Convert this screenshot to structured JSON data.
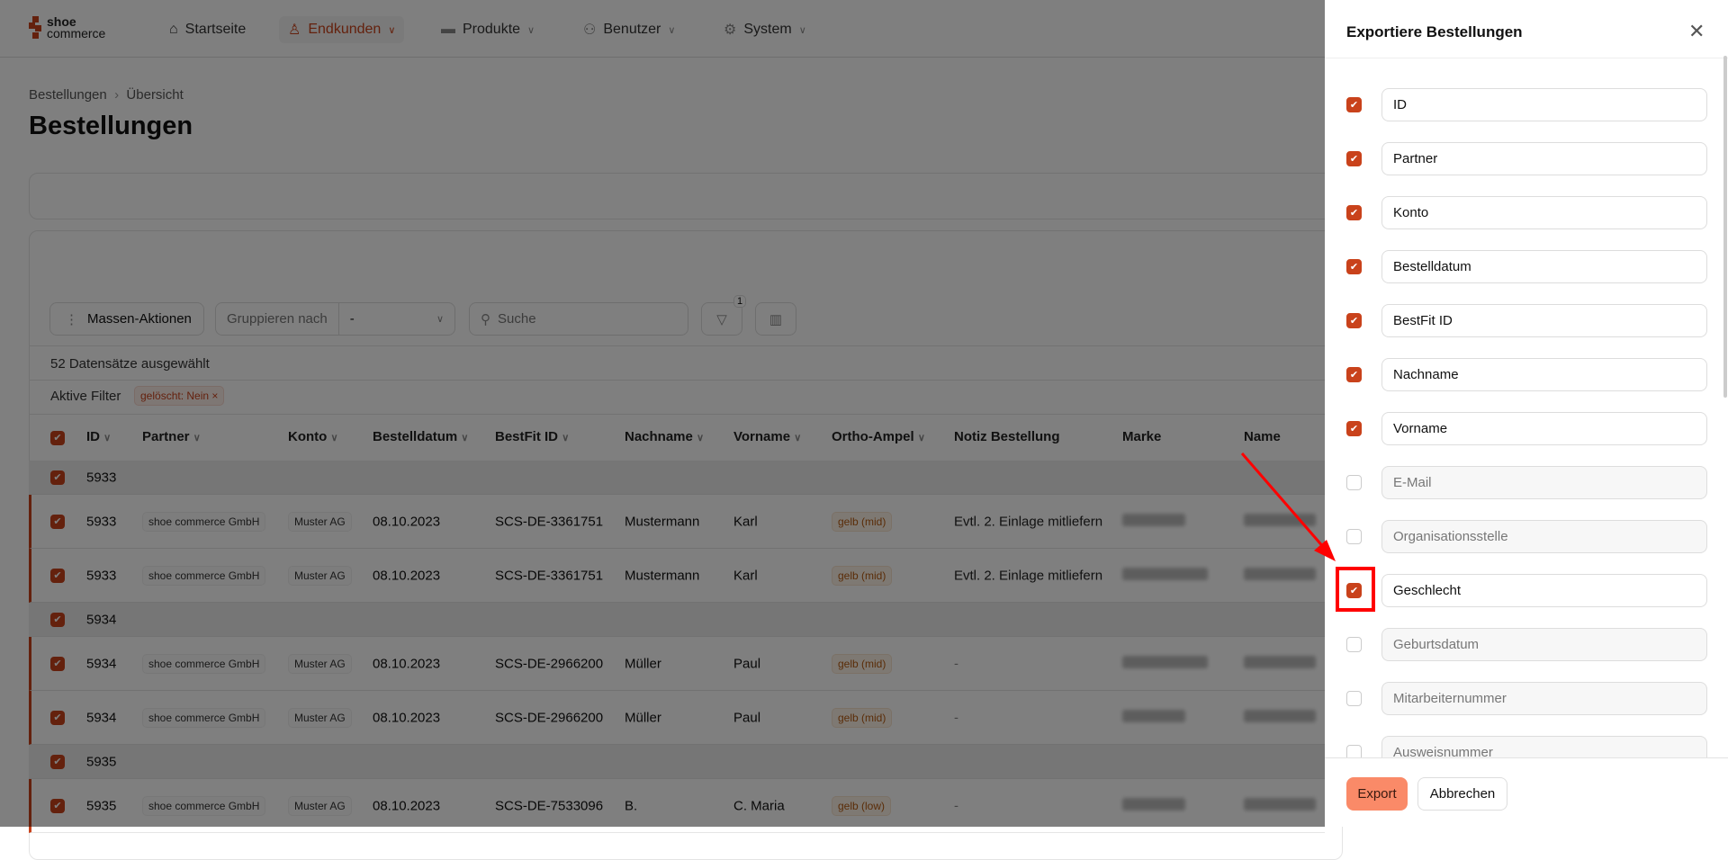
{
  "nav": {
    "logo": [
      "shoe",
      "commerce"
    ],
    "items": [
      {
        "label": "Startseite",
        "icon": "home-icon"
      },
      {
        "label": "Endkunden",
        "icon": "user-icon",
        "active": true
      },
      {
        "label": "Produkte",
        "icon": "shoe-icon"
      },
      {
        "label": "Benutzer",
        "icon": "users-icon"
      },
      {
        "label": "System",
        "icon": "gear-icon"
      }
    ]
  },
  "breadcrumb": [
    "Bestellungen",
    "Übersicht"
  ],
  "page_title": "Bestellungen",
  "toolbar": {
    "mass_actions": "Massen-Aktionen",
    "group_by_label": "Gruppieren nach",
    "group_by_value": "-",
    "search_placeholder": "Suche",
    "filter_count": "1"
  },
  "selected_text": "52 Datensätze ausgewählt",
  "active_filters": {
    "label": "Aktive Filter",
    "filters": [
      "gelöscht: Nein"
    ]
  },
  "table": {
    "headers": [
      "ID",
      "Partner",
      "Konto",
      "Bestelldatum",
      "BestFit ID",
      "Nachname",
      "Vorname",
      "Ortho-Ampel",
      "Notiz Bestellung",
      "Marke",
      "Name"
    ],
    "rows": [
      {
        "group": "5933"
      },
      {
        "id": "5933",
        "partner": "shoe commerce GmbH",
        "konto": "Muster AG",
        "datum": "08.10.2023",
        "bestfit": "SCS-DE-3361751",
        "nachname": "Mustermann",
        "vorname": "Karl",
        "ampel": "gelb (mid)",
        "notiz": "Evtl. 2. Einlage mitliefern"
      },
      {
        "id": "5933",
        "partner": "shoe commerce GmbH",
        "konto": "Muster AG",
        "datum": "08.10.2023",
        "bestfit": "SCS-DE-3361751",
        "nachname": "Mustermann",
        "vorname": "Karl",
        "ampel": "gelb (mid)",
        "notiz": "Evtl. 2. Einlage mitliefern"
      },
      {
        "group": "5934"
      },
      {
        "id": "5934",
        "partner": "shoe commerce GmbH",
        "konto": "Muster AG",
        "datum": "08.10.2023",
        "bestfit": "SCS-DE-2966200",
        "nachname": "Müller",
        "vorname": "Paul",
        "ampel": "gelb (mid)",
        "notiz": "-"
      },
      {
        "id": "5934",
        "partner": "shoe commerce GmbH",
        "konto": "Muster AG",
        "datum": "08.10.2023",
        "bestfit": "SCS-DE-2966200",
        "nachname": "Müller",
        "vorname": "Paul",
        "ampel": "gelb (mid)",
        "notiz": "-"
      },
      {
        "group": "5935"
      },
      {
        "id": "5935",
        "partner": "shoe commerce GmbH",
        "konto": "Muster AG",
        "datum": "08.10.2023",
        "bestfit": "SCS-DE-7533096",
        "nachname": "B.",
        "vorname": "C. Maria",
        "ampel": "gelb (low)",
        "notiz": "-"
      }
    ]
  },
  "drawer": {
    "title": "Exportiere Bestellungen",
    "fields": [
      {
        "label": "ID",
        "checked": true
      },
      {
        "label": "Partner",
        "checked": true
      },
      {
        "label": "Konto",
        "checked": true
      },
      {
        "label": "Bestelldatum",
        "checked": true
      },
      {
        "label": "BestFit ID",
        "checked": true
      },
      {
        "label": "Nachname",
        "checked": true
      },
      {
        "label": "Vorname",
        "checked": true
      },
      {
        "label": "E-Mail",
        "checked": false
      },
      {
        "label": "Organisationsstelle",
        "checked": false
      },
      {
        "label": "Geschlecht",
        "checked": true
      },
      {
        "label": "Geburtsdatum",
        "checked": false
      },
      {
        "label": "Mitarbeiternummer",
        "checked": false
      },
      {
        "label": "Ausweisnummer",
        "checked": false
      }
    ],
    "export": "Export",
    "cancel": "Abbrechen"
  },
  "colors": {
    "accent": "#c9421b",
    "export_button": "#fa8a68",
    "annotation": "#ff0000"
  }
}
